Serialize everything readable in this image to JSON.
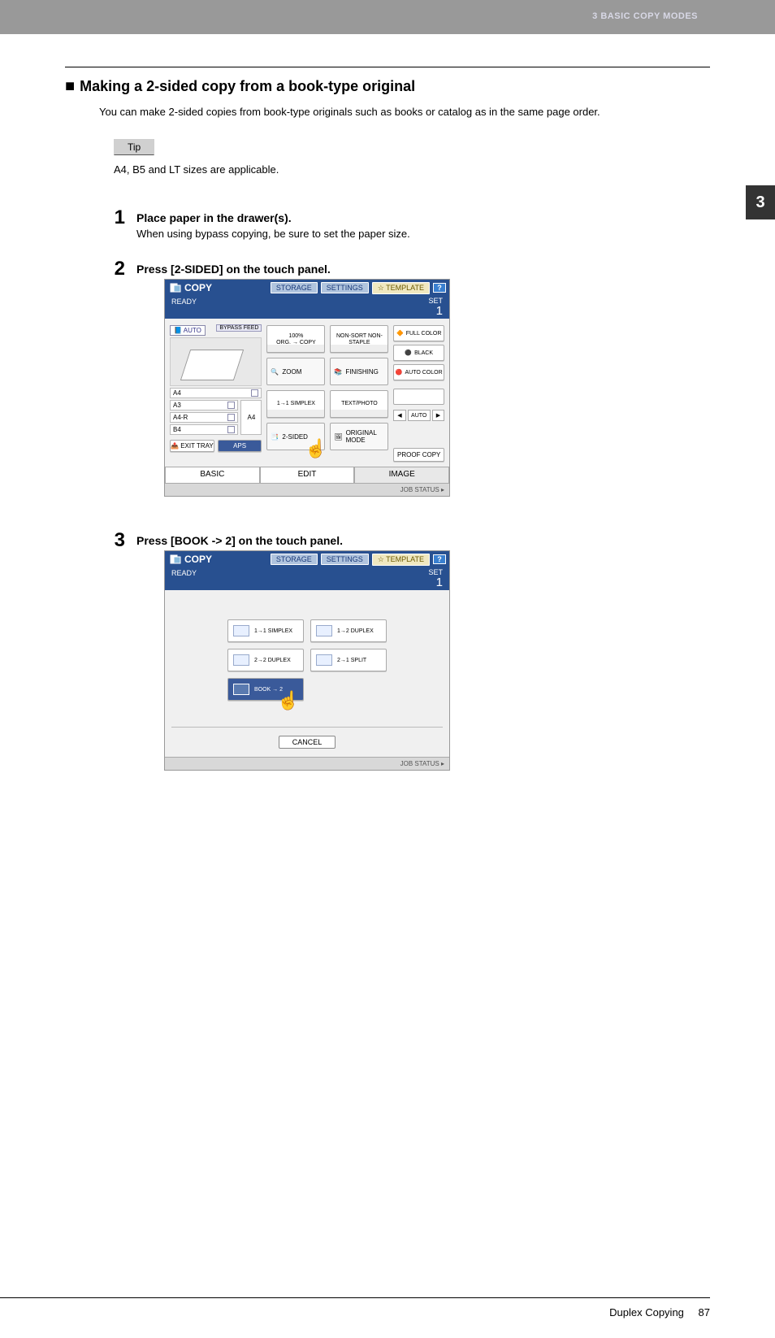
{
  "header": {
    "chapter": "3 BASIC COPY MODES"
  },
  "side_tab": "3",
  "section": {
    "marker": "■",
    "title": "Making a 2-sided copy from a book-type original",
    "intro": "You can make 2-sided copies from book-type originals such as books or catalog as in the same page order."
  },
  "tip": {
    "label": "Tip",
    "text": "A4, B5 and LT sizes are applicable."
  },
  "steps": [
    {
      "num": "1",
      "title": "Place paper in the drawer(s).",
      "detail": "When using bypass copying, be sure to set the paper size."
    },
    {
      "num": "2",
      "title": "Press [2-SIDED] on the touch panel."
    },
    {
      "num": "3",
      "title": "Press [BOOK -> 2] on the touch panel."
    }
  ],
  "panel1": {
    "title": "COPY",
    "header_buttons": {
      "storage": "STORAGE",
      "settings": "SETTINGS",
      "template": "TEMPLATE",
      "help": "?"
    },
    "status": "READY",
    "set_label": "SET",
    "set_value": "1",
    "auto_badge": "AUTO",
    "trays": {
      "a4": "A4",
      "a3": "A3",
      "a4r": "A4-R",
      "b4": "B4",
      "side": "A4"
    },
    "bypass": "BYPASS FEED",
    "exit_tray": "EXIT TRAY",
    "aps": "APS",
    "mid": {
      "ratio": "100%",
      "orgcopy": "ORG. → COPY",
      "nonsort": "NON-SORT NON-STAPLE",
      "zoom": "ZOOM",
      "finishing": "FINISHING",
      "simplex": "1→1 SIMPLEX",
      "textphoto": "TEXT/PHOTO",
      "twosided": "2-SIDED",
      "origmode": "ORIGINAL MODE"
    },
    "right": {
      "full": "FULL COLOR",
      "black": "BLACK",
      "auto": "AUTO COLOR",
      "auto_slider": "AUTO",
      "proof": "PROOF COPY"
    },
    "tabs": {
      "basic": "BASIC",
      "edit": "EDIT",
      "image": "IMAGE"
    },
    "job_status": "JOB STATUS"
  },
  "panel2": {
    "title": "COPY",
    "header_buttons": {
      "storage": "STORAGE",
      "settings": "SETTINGS",
      "template": "TEMPLATE",
      "help": "?"
    },
    "status": "READY",
    "set_label": "SET",
    "set_value": "1",
    "options": {
      "simplex11": "1→1 SIMPLEX",
      "duplex12": "1→2 DUPLEX",
      "duplex22": "2→2 DUPLEX",
      "split21": "2→1 SPLIT",
      "book2": "BOOK → 2"
    },
    "cancel": "CANCEL",
    "job_status": "JOB STATUS"
  },
  "footer": {
    "section": "Duplex Copying",
    "page": "87"
  }
}
